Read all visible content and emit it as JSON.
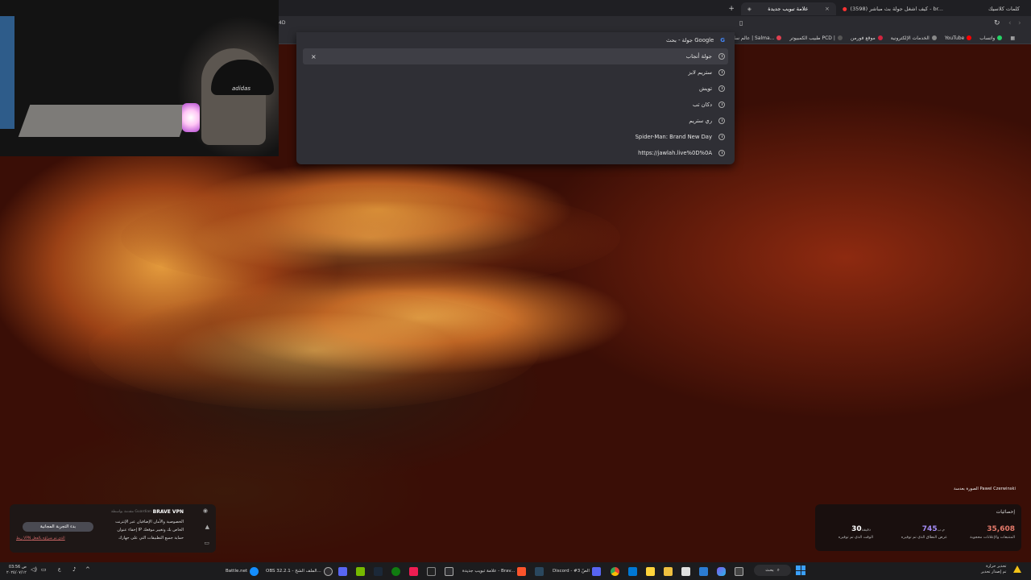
{
  "browser": {
    "tabs": [
      {
        "title": "علامة تبويب جديدة",
        "active": true
      },
      {
        "title": "(3598) كيف اشغل جولة بث مباشر - br...",
        "active": false
      },
      {
        "title": "كلمات كلاسيك",
        "active": false
      }
    ],
    "new_tab_icon": "plus-icon",
    "bookmarks": [
      {
        "label": "واتساب",
        "icon": "whatsapp-icon",
        "color": "#25d366"
      },
      {
        "label": "YouTube",
        "icon": "youtube-icon",
        "color": "#ff0000"
      },
      {
        "label": "الخدمات الإلكترونية",
        "icon": "globe-icon",
        "color": "#aaaaaa"
      },
      {
        "label": "موقع فورمن",
        "icon": "forum-icon",
        "color": "#d0253f"
      },
      {
        "label": "طبيب الكمبيوتر PCD |",
        "icon": "pcd-icon",
        "color": "#222222"
      },
      {
        "label": "عالم سلمى | Salma...",
        "icon": "salma-icon",
        "color": "#e04050"
      }
    ]
  },
  "omnibox_dropdown": {
    "suggestions": [
      {
        "text": "جولة - بحث Google",
        "icon": "google-icon"
      },
      {
        "text": "جولة أنجاب",
        "icon": "history-icon",
        "hover": true
      },
      {
        "text": "ستريم لابز",
        "icon": "history-icon"
      },
      {
        "text": "تويش",
        "icon": "history-icon"
      },
      {
        "text": "دكان تب",
        "icon": "history-icon"
      },
      {
        "text": "ري ستريم",
        "icon": "history-icon"
      },
      {
        "text": "Spider-Man: Brand New Day",
        "icon": "history-icon"
      },
      {
        "text": "https://jawlah.live%0D%0A",
        "icon": "history-icon"
      }
    ],
    "remove_label": "×"
  },
  "webcam": {
    "cap_text": "adidas"
  },
  "vpn_popup": {
    "title": "BRAVE VPN",
    "subtitle": "مقدمة بواسطة Guardian",
    "lines": [
      "الخصوصية والأمان الإضافيان عبر الإنترنت",
      "إخفاء عنوان IP الخاص بك وتغيير موقعك",
      "حماية جميع التطبيقات التي على جهازك"
    ],
    "button": "بدء التجربة المجانية",
    "link": "ربط VPN الذي تم شراؤه بالفعل"
  },
  "stats_panel": {
    "title": "إحصائيات",
    "items": [
      {
        "value": "35,608",
        "unit": "",
        "label": "المتتبعات والإعلانات محجوبة",
        "color": "#e57a6b"
      },
      {
        "value": "745",
        "unit": "م.ب",
        "label": "عرض النطاق الذي تم توفيره",
        "color": "#a48cf5"
      },
      {
        "value": "30",
        "unit": "دقيقة",
        "label": "الوقت الذي تم توفيره",
        "color": "#ffffff"
      }
    ]
  },
  "photo_credit": "الصورة بعدسة Pawel Czerwinski",
  "taskbar": {
    "time": "03:56 ص",
    "date": "٢٠٢٥/٠٧/١٢",
    "lang": "ع",
    "items": [
      {
        "label": "Battle.net",
        "icon": "battlenet-icon",
        "color": "#148eff"
      },
      {
        "label": "OBS 32.2.1 - الملف الشخ...",
        "icon": "obs-icon",
        "color": "#302e31"
      },
      {
        "label": "",
        "icon": "discord-icon",
        "color": "#5865f2"
      },
      {
        "label": "",
        "icon": "nvidia-icon",
        "color": "#76b900"
      },
      {
        "label": "",
        "icon": "steam-icon",
        "color": "#1b2838"
      },
      {
        "label": "",
        "icon": "xbox-icon",
        "color": "#107c10"
      },
      {
        "label": "",
        "icon": "tiktok-icon",
        "color": "#ee1d52"
      },
      {
        "label": "",
        "icon": "capcut-icon",
        "color": "#222222"
      },
      {
        "label": "علامة تبويب جديدة - Brav...",
        "icon": "brave-icon",
        "color": "#fb542b"
      },
      {
        "label": "",
        "icon": "steam2-icon",
        "color": "#2a475e"
      },
      {
        "label": "Discord - #الصّ 3",
        "icon": "discord2-icon",
        "color": "#5865f2"
      },
      {
        "label": "",
        "icon": "chrome-icon",
        "color": "#4285f4"
      },
      {
        "label": "",
        "icon": "store-icon",
        "color": "#0078d4"
      },
      {
        "label": "",
        "icon": "explorer-icon",
        "color": "#f0c040"
      },
      {
        "label": "",
        "icon": "copilot-icon",
        "color": "#7f5af0"
      },
      {
        "label": "",
        "icon": "taskview-icon",
        "color": "#444444"
      }
    ],
    "search_label": "بحث",
    "notification": {
      "line1": "تحذير حرارة",
      "line2": "تم إصدار تحذير"
    }
  }
}
